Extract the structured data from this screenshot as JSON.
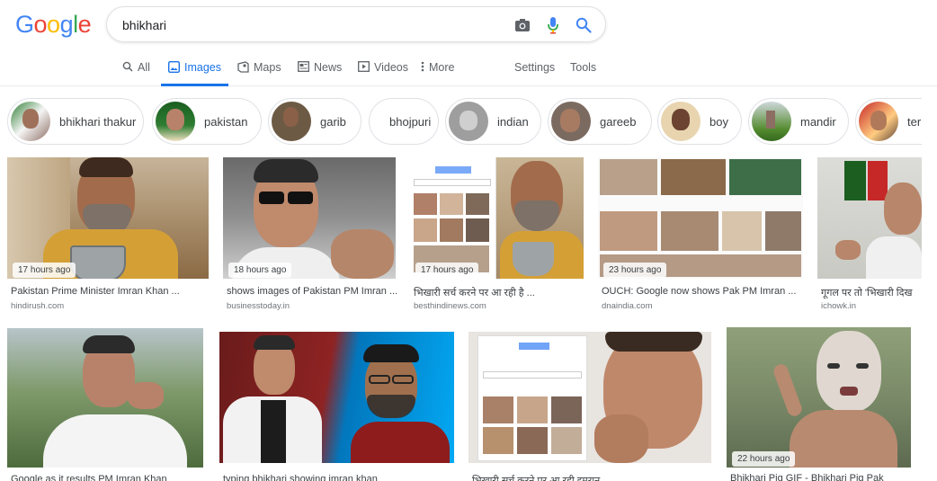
{
  "logo": "Google",
  "search": {
    "query": "bhikhari"
  },
  "tabs": [
    {
      "label": "All",
      "icon": "search-icon"
    },
    {
      "label": "Images",
      "icon": "image-icon"
    },
    {
      "label": "Maps",
      "icon": "map-icon"
    },
    {
      "label": "News",
      "icon": "news-icon"
    },
    {
      "label": "Videos",
      "icon": "video-icon"
    },
    {
      "label": "More",
      "icon": "more-icon"
    }
  ],
  "tools": {
    "settings": "Settings",
    "tools": "Tools"
  },
  "chips": [
    {
      "label": "bhikhari thakur"
    },
    {
      "label": "pakistan"
    },
    {
      "label": "garib"
    },
    {
      "label": "bhojpuri"
    },
    {
      "label": "indian"
    },
    {
      "label": "gareeb"
    },
    {
      "label": "boy"
    },
    {
      "label": "mandir"
    },
    {
      "label": "ter"
    }
  ],
  "results": [
    {
      "time": "17 hours ago",
      "title": "Pakistan Prime Minister Imran Khan ...",
      "source": "hindirush.com"
    },
    {
      "time": "18 hours ago",
      "title": "shows images of Pakistan PM Imran ...",
      "source": "businesstoday.in"
    },
    {
      "time": "17 hours ago",
      "title": "भिखारी सर्च करने पर आ रही है ...",
      "source": "besthindinews.com"
    },
    {
      "time": "23 hours ago",
      "title": "OUCH: Google now shows Pak PM Imran ...",
      "source": "dnaindia.com"
    },
    {
      "time": "",
      "title": "गूगल पर तो 'भिखारी दिख",
      "source": "ichowk.in"
    },
    {
      "time": "",
      "title": "Google as it results PM Imran Khan",
      "source": ""
    },
    {
      "time": "",
      "title": "typing bhikhari showing imran khan",
      "source": ""
    },
    {
      "time": "",
      "title": "भिखारी सर्च करने पर आ रही इमरान",
      "source": ""
    },
    {
      "time": "22 hours ago",
      "title": "Bhikhari Pig GIF - Bhikhari Pig Pak",
      "source": ""
    }
  ],
  "colors": {
    "accent": "#1a73e8",
    "muted": "#5f6368",
    "border": "#dfe1e5"
  }
}
